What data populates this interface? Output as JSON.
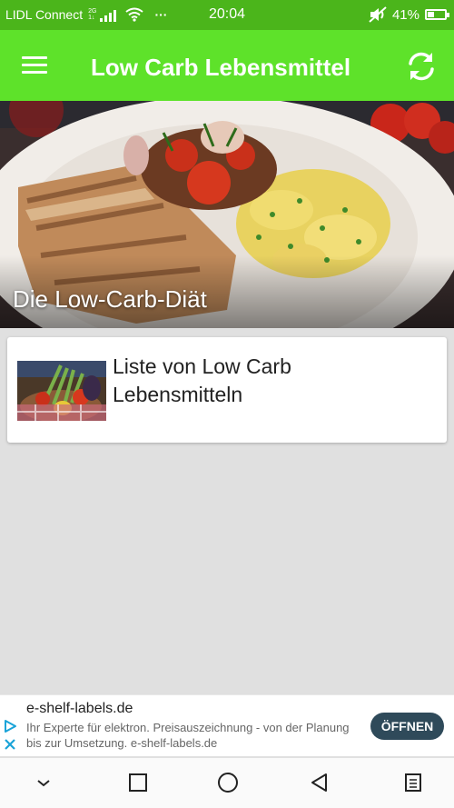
{
  "status_bar": {
    "carrier": "LIDL Connect",
    "network_tag_top": "2G",
    "network_tag_bottom": "1↓",
    "overflow": "···",
    "time": "20:04",
    "battery": "41%",
    "battery_level": 0.41,
    "icons": [
      "signal-icon",
      "wifi-icon",
      "volume-icon",
      "battery-icon"
    ]
  },
  "app_bar": {
    "menu_icon": "hamburger-icon",
    "title": "Low Carb Lebensmittel",
    "refresh_icon": "refresh-icon",
    "color": "#5ee22a",
    "status_color": "#4bb51b"
  },
  "hero": {
    "caption": "Die Low-Carb-Diät"
  },
  "card": {
    "label": "Liste von Low Carb Lebensmitteln"
  },
  "ad": {
    "title": "e-shelf-labels.de",
    "text": "Ihr Experte für elektron. Preisauszeichnung - von der Planung bis zur Umsetzung. e-shelf-labels.de",
    "button": "ÖFFNEN",
    "icons": [
      "adchoices-icon",
      "close-icon"
    ]
  },
  "nav_bar": {
    "icons": [
      "chevron-down-icon",
      "recents-icon",
      "home-icon",
      "back-icon",
      "menu-icon"
    ]
  }
}
